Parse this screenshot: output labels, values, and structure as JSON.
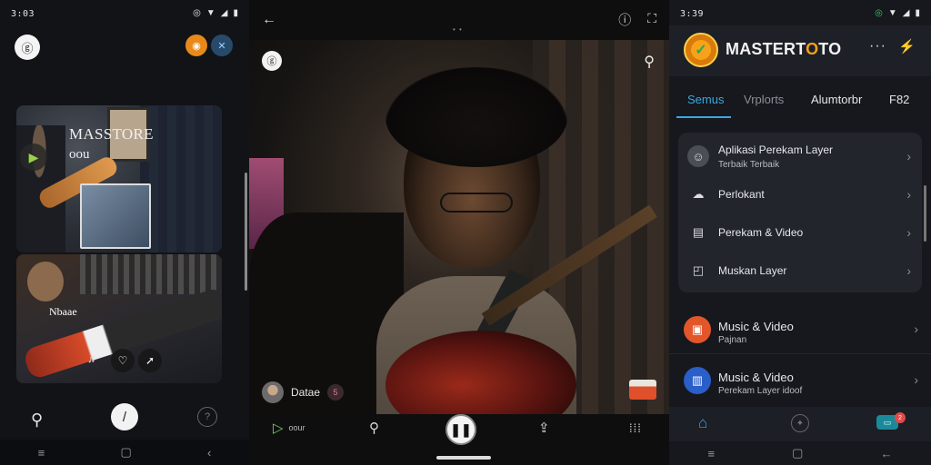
{
  "left": {
    "status_time": "3:03",
    "card1": {
      "title": "MASSTORE",
      "subtitle": "oou"
    },
    "card2": {
      "label": "Nbaae"
    }
  },
  "middle": {
    "badge": {
      "name": "Datae",
      "count": "5"
    },
    "nav": {
      "item1_label": "oour"
    }
  },
  "right": {
    "status_time": "3:39",
    "header": {
      "title_pre": "MASTERT",
      "title_o": "O",
      "title_post": "TO"
    },
    "tabs": [
      "Semus",
      "Vrplorts",
      "Alumtorbr",
      "F82"
    ],
    "card_items": [
      {
        "label": "Aplikasi Perekam Layer",
        "sub": "Terbaik Terbaik"
      },
      {
        "label": "Perlokant"
      },
      {
        "label": "Perekam & Video"
      },
      {
        "label": "Muskan Layer"
      }
    ],
    "list_items": [
      {
        "label": "Music & Video",
        "sub": "Pajnan"
      },
      {
        "label": "Music & Video",
        "sub": "Perekam Layer idoof"
      }
    ],
    "nav_badge": "2"
  }
}
